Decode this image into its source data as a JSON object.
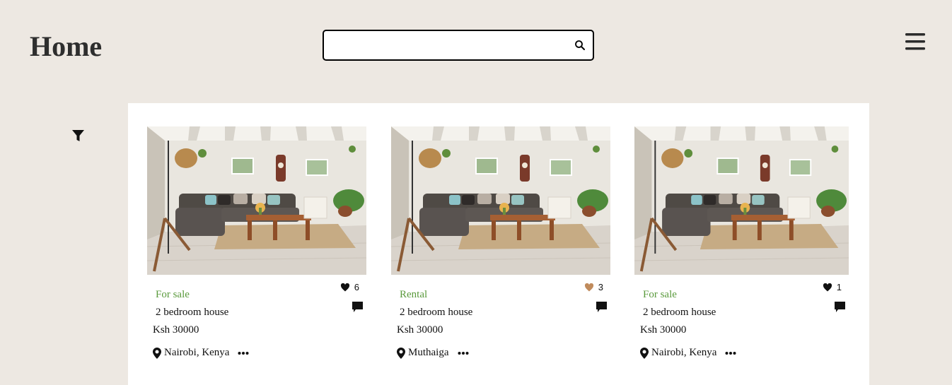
{
  "header": {
    "title": "Home",
    "search": {
      "value": "",
      "placeholder": ""
    }
  },
  "icons": {
    "menu": "menu-icon",
    "search": "search-icon",
    "filter": "filter-icon",
    "like": "heart-icon",
    "comment": "comment-icon",
    "location": "map-pin-icon",
    "more": "more-icon"
  },
  "colors": {
    "page_background": "#ede8e2",
    "panel_background": "#ffffff",
    "status_green": "#5a9a3c",
    "heart_default": "#111111",
    "heart_liked": "#c08b5c"
  },
  "listings": [
    {
      "status": "For sale",
      "title": " 2 bedroom house",
      "price": "Ksh 30000",
      "location": "Nairobi, Kenya",
      "likes": "6",
      "liked": false
    },
    {
      "status": "Rental",
      "title": " 2 bedroom house",
      "price": "Ksh 30000",
      "location": "Muthaiga",
      "likes": "3",
      "liked": true
    },
    {
      "status": "For sale",
      "title": " 2 bedroom house",
      "price": "Ksh 30000",
      "location": "Nairobi, Kenya",
      "likes": "1",
      "liked": false
    }
  ]
}
